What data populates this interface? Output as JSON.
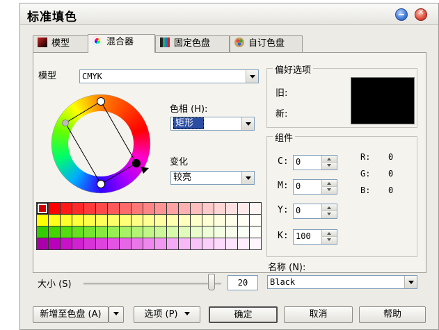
{
  "window": {
    "title": "标准填色"
  },
  "tabs": [
    {
      "label": "模型",
      "icon": "color-model-icon"
    },
    {
      "label": "混合器",
      "icon": "color-mixer-icon"
    },
    {
      "label": "固定色盘",
      "icon": "fixed-palette-icon"
    },
    {
      "label": "自订色盘",
      "icon": "custom-palette-icon"
    }
  ],
  "mixer": {
    "model_label": "模型",
    "model_value": "CMYK",
    "hue_label": "色相 (H):",
    "hue_value": "矩形",
    "variation_label": "变化",
    "variation_value": "较亮",
    "size_label": "大小 (S)",
    "size_value": "20",
    "size_level": 0.95
  },
  "preference": {
    "title": "偏好选项",
    "old_label": "旧:",
    "new_label": "新:",
    "old_color": "#000000",
    "new_color": "#000000"
  },
  "components": {
    "title": "组件",
    "c_label": "C:",
    "c_value": "0",
    "m_label": "M:",
    "m_value": "0",
    "y_label": "Y:",
    "y_value": "0",
    "k_label": "K:",
    "k_value": "100",
    "r_label": "R:",
    "r_value": "0",
    "g_label": "G:",
    "g_value": "0",
    "b_label": "B:",
    "b_value": "0"
  },
  "name": {
    "label": "名称 (N):",
    "value": "Black"
  },
  "buttons": {
    "add_to_palette": "新增至色盘 (A)",
    "options": "选项 (P)",
    "ok": "确定",
    "cancel": "取消",
    "help": "帮助"
  },
  "swatch_rows": [
    [
      "#cc0000",
      "#ff0000",
      "#ff1a1a",
      "#ff2b2b",
      "#ff3b3b",
      "#ff4a4a",
      "#ff5a5a",
      "#ff6a6a",
      "#ff7878",
      "#ff8686",
      "#ff9494",
      "#ffa2a2",
      "#ffb0b0",
      "#ffbebe",
      "#ffcaca",
      "#ffd6d6",
      "#ffe0e0",
      "#ffeaea",
      "#fff4f4"
    ],
    [
      "#ffff00",
      "#ffff1a",
      "#ffff2b",
      "#ffff3b",
      "#ffff4a",
      "#ffff5a",
      "#ffff6a",
      "#ffff78",
      "#ffff86",
      "#ffff94",
      "#ffffa2",
      "#ffffb0",
      "#ffffbe",
      "#ffffca",
      "#ffffd6",
      "#ffffe0",
      "#ffffea",
      "#fffff2",
      "#fffff8"
    ],
    [
      "#33cc00",
      "#44d400",
      "#55dc10",
      "#66e020",
      "#77e530",
      "#88e940",
      "#99ed55",
      "#a8f066",
      "#b5f377",
      "#c2f688",
      "#cdf899",
      "#d7faaa",
      "#e0fbbb",
      "#e8fccc",
      "#eefdd8",
      "#f3fee2",
      "#f7feec",
      "#fafff3",
      "#fdfff8"
    ],
    [
      "#aa00aa",
      "#bb00bb",
      "#c811c8",
      "#d022d0",
      "#d733d7",
      "#dd44dd",
      "#e255e2",
      "#e666e6",
      "#ea77ea",
      "#ee88ee",
      "#f199f1",
      "#f4aaf4",
      "#f6b8f6",
      "#f8c4f8",
      "#fad0fa",
      "#fbdafb",
      "#fce4fc",
      "#fdedfd",
      "#fef5fe"
    ]
  ],
  "colors": {
    "selected_field": "#2b4ea3",
    "window_bg": "#ecebe6"
  }
}
